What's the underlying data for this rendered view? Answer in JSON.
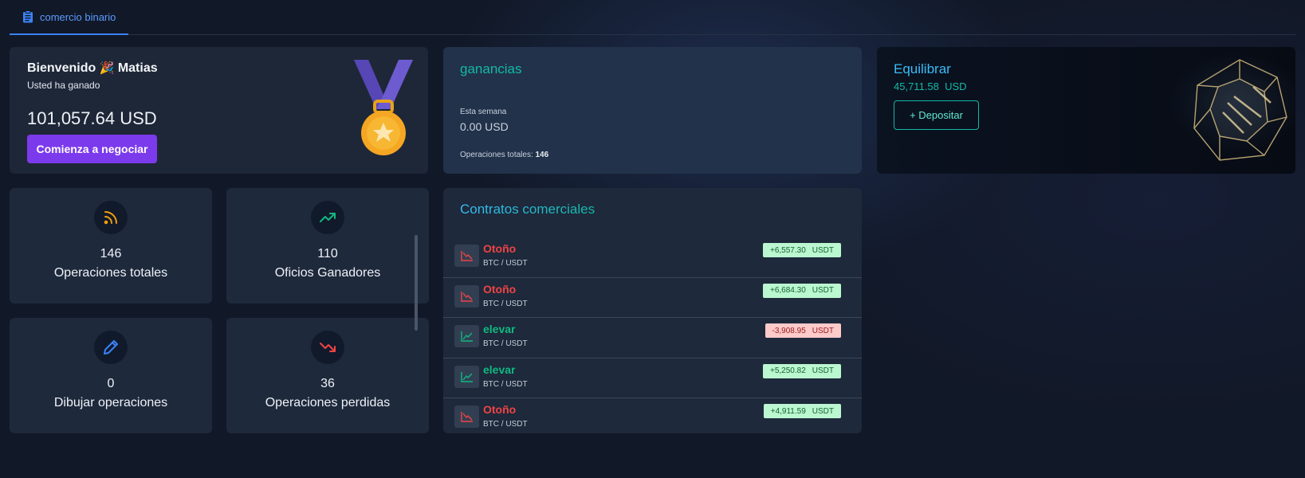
{
  "tab": {
    "label": "comercio binario"
  },
  "welcome": {
    "greeting": "Bienvenido",
    "emoji": "🎉",
    "name": "Matias",
    "subtitle": "Usted ha ganado",
    "amount": "101,057.64 USD",
    "cta_label": "Comienza a negociar"
  },
  "earnings": {
    "title": "ganancias",
    "week_label": "Esta semana",
    "week_value": "0.00 USD",
    "total_label": "Operaciones totales:",
    "total_value": "146"
  },
  "balance": {
    "title": "Equilibrar",
    "amount": "45,711.58",
    "currency": "USD",
    "deposit_label": "+ Depositar"
  },
  "stats": [
    {
      "value": "146",
      "label": "Operaciones totales",
      "icon": "rss-icon",
      "color": "#f59e0b"
    },
    {
      "value": "110",
      "label": "Oficios Ganadores",
      "icon": "trending-up-icon",
      "color": "#10b981"
    },
    {
      "value": "0",
      "label": "Dibujar operaciones",
      "icon": "pencil-icon",
      "color": "#3b82f6"
    },
    {
      "value": "36",
      "label": "Operaciones perdidas",
      "icon": "trending-down-icon",
      "color": "#ef4444"
    }
  ],
  "contracts": {
    "title": "Contratos comerciales",
    "rows": [
      {
        "type": "Otoño",
        "direction": "down",
        "pair": "BTC / USDT",
        "amount": "+6,557.30",
        "unit": "USDT",
        "sign": "pos"
      },
      {
        "type": "Otoño",
        "direction": "down",
        "pair": "BTC / USDT",
        "amount": "+6,684.30",
        "unit": "USDT",
        "sign": "pos"
      },
      {
        "type": "elevar",
        "direction": "up",
        "pair": "BTC / USDT",
        "amount": "-3,908.95",
        "unit": "USDT",
        "sign": "neg"
      },
      {
        "type": "elevar",
        "direction": "up",
        "pair": "BTC / USDT",
        "amount": "+5,250.82",
        "unit": "USDT",
        "sign": "pos"
      },
      {
        "type": "Otoño",
        "direction": "down",
        "pair": "BTC / USDT",
        "amount": "+4,911.59",
        "unit": "USDT",
        "sign": "pos"
      }
    ]
  },
  "colors": {
    "accent_blue": "#3b82f6",
    "accent_teal": "#14b8a6",
    "cta_purple": "#7c3aed",
    "down_red": "#ef4444",
    "up_green": "#10b981"
  }
}
